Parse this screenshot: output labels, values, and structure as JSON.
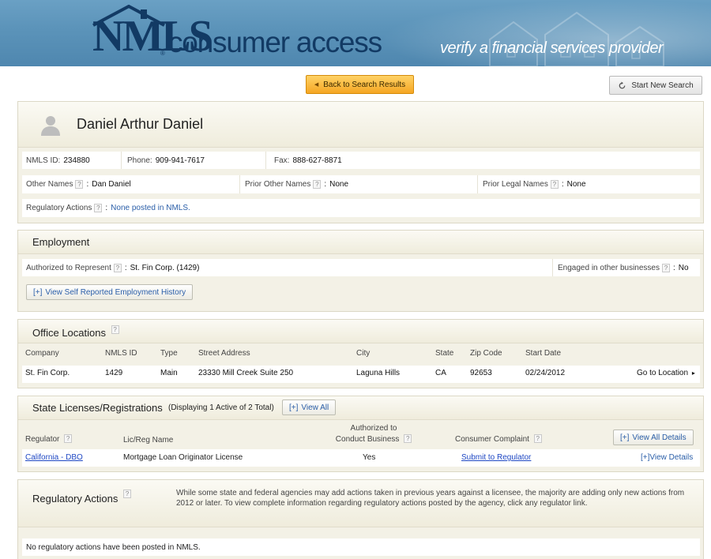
{
  "header": {
    "logo_mark": "NMLS",
    "logo_reg": "®",
    "logo_text": "consumer access",
    "tagline": "verify a financial services provider"
  },
  "toolbar": {
    "back_label": "Back to Search Results",
    "new_search_label": "Start New Search"
  },
  "person": {
    "name": "Daniel Arthur Daniel",
    "nmls_id_label": "NMLS ID:",
    "nmls_id": "234880",
    "phone_label": "Phone:",
    "phone": "909-941-7617",
    "fax_label": "Fax:",
    "fax": "888-627-8871",
    "other_names_label": "Other Names",
    "other_names": "Dan Daniel",
    "prior_other_names_label": "Prior Other Names",
    "prior_other_names": "None",
    "prior_legal_names_label": "Prior Legal Names",
    "prior_legal_names": "None",
    "regulatory_actions_label": "Regulatory Actions",
    "regulatory_actions": "None posted in NMLS."
  },
  "employment": {
    "title": "Employment",
    "authorized_label": "Authorized to Represent",
    "authorized_value": "St. Fin Corp. (1429)",
    "engaged_label": "Engaged in other businesses",
    "engaged_value": "No",
    "history_button": "View Self Reported Employment History",
    "plus_prefix": "[+]"
  },
  "offices": {
    "title": "Office Locations",
    "columns": [
      "Company",
      "NMLS ID",
      "Type",
      "Street Address",
      "City",
      "State",
      "Zip Code",
      "Start Date"
    ],
    "rows": [
      {
        "company": "St. Fin Corp.",
        "nmls_id": "1429",
        "type": "Main",
        "street": "23330 Mill Creek Suite 250",
        "city": "Laguna Hills",
        "state": "CA",
        "zip": "92653",
        "start_date": "02/24/2012",
        "action": "Go to Location"
      }
    ]
  },
  "licenses": {
    "title": "State Licenses/Registrations",
    "displaying": "(Displaying 1 Active of 2 Total)",
    "view_all": "View All",
    "view_all_details": "View All Details",
    "col_regulator": "Regulator",
    "col_name": "Lic/Reg Name",
    "col_authorized_1": "Authorized to",
    "col_authorized_2": "Conduct Business",
    "col_complaint": "Consumer Complaint",
    "rows": [
      {
        "regulator": "California - DBO",
        "name": "Mortgage Loan Originator License",
        "authorized": "Yes",
        "complaint": "Submit to Regulator",
        "details": "View Details"
      }
    ]
  },
  "regulatory": {
    "title": "Regulatory Actions",
    "note": "While some state and federal agencies may add actions taken in previous years against a licensee, the majority are adding only new actions from 2012 or later. To view complete information regarding regulatory actions posted by the agency, click any regulator link.",
    "empty": "No regulatory actions have been posted in NMLS."
  },
  "icons": {
    "help": "question-mark-icon",
    "back": "triangle-left-icon",
    "refresh": "refresh-icon",
    "avatar": "person-silhouette-icon",
    "chevron": "chevron-right-icon"
  },
  "colors": {
    "banner": "#5b93b9",
    "brand": "#123a64",
    "back_button": "#f5a623",
    "link": "#2a5ea8",
    "panel": "#f3f1e6"
  }
}
